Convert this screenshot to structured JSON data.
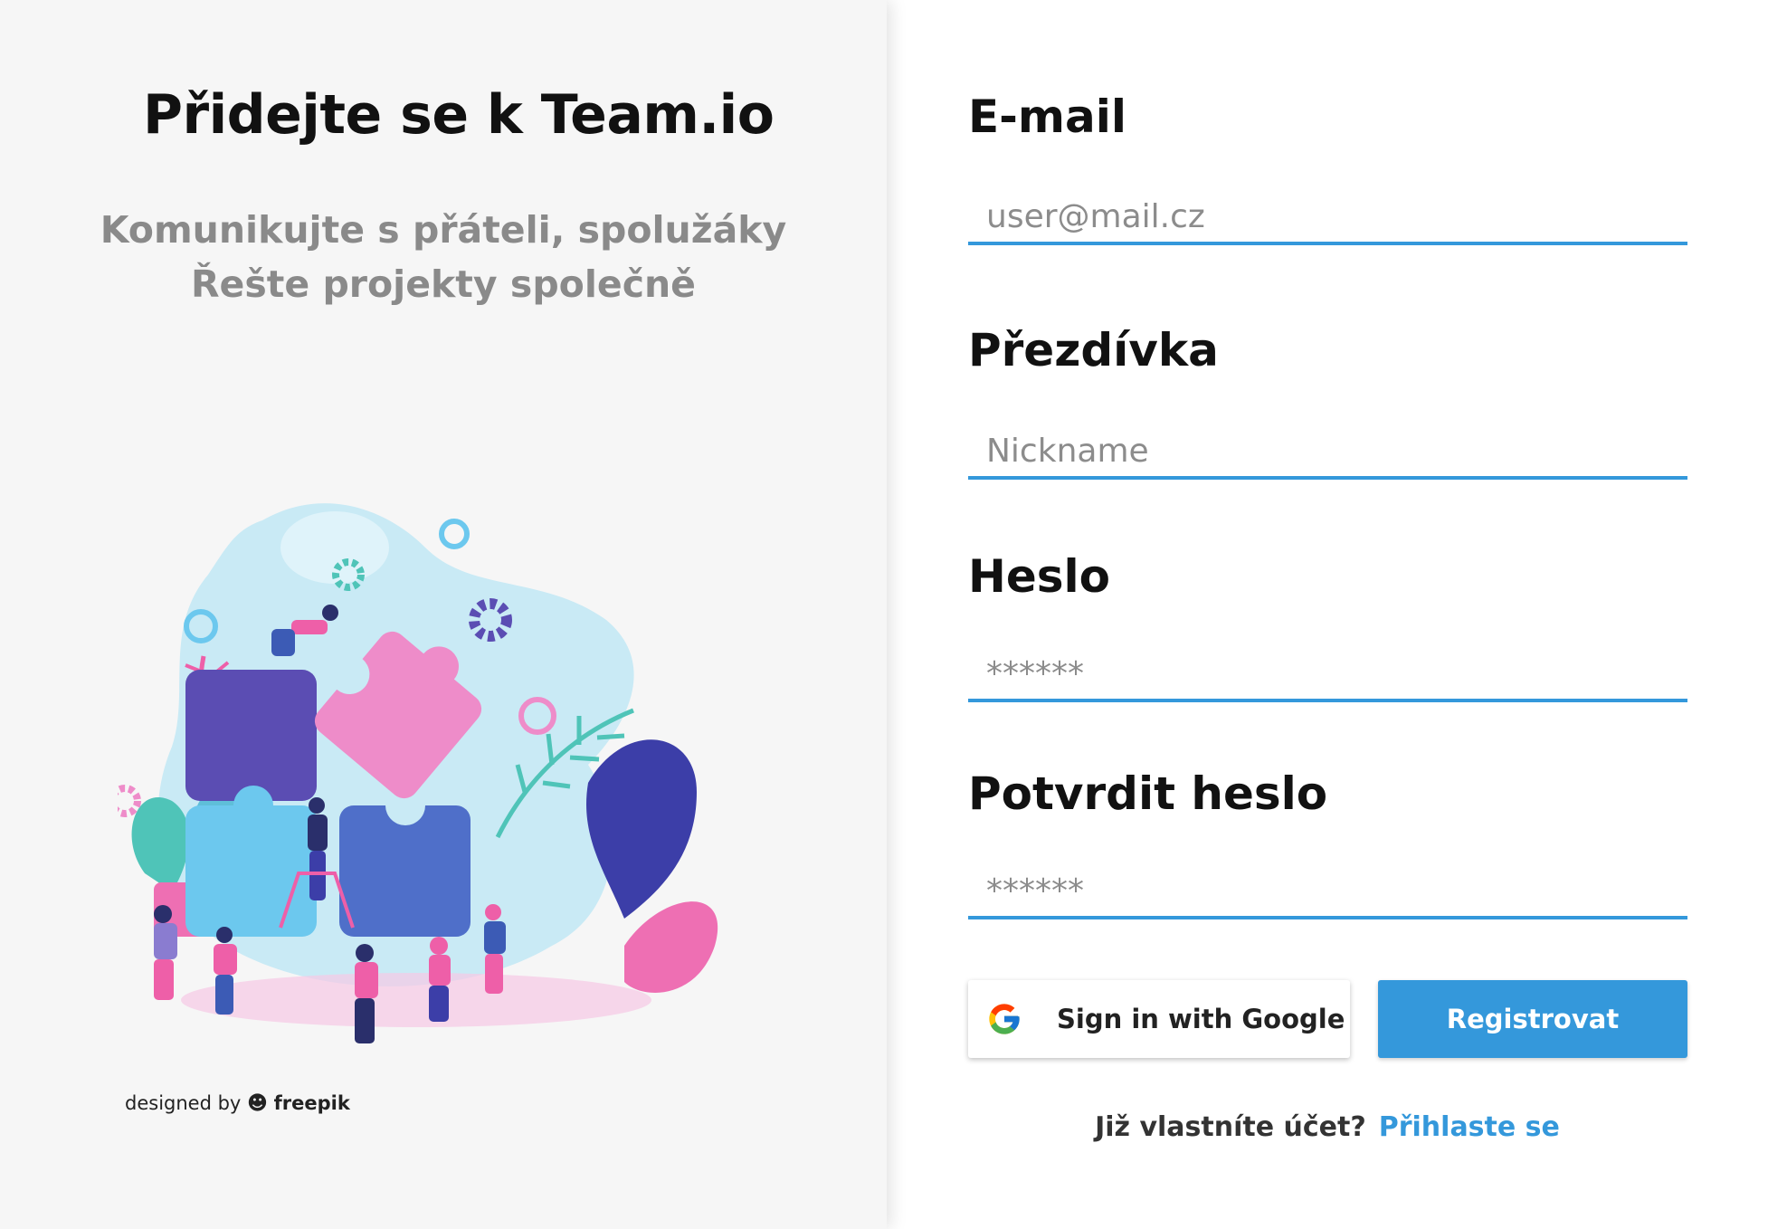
{
  "left": {
    "title": "Přidejte se k Team.io",
    "subtitle_line1": "Komunikujte s přáteli, spolužáky",
    "subtitle_line2": "Řešte projekty společně",
    "credit_prefix": "designed by",
    "credit_brand": "freepik"
  },
  "form": {
    "email": {
      "label": "E-mail",
      "placeholder": "user@mail.cz"
    },
    "nickname": {
      "label": "Přezdívka",
      "placeholder": "Nickname"
    },
    "password": {
      "label": "Heslo",
      "placeholder": "******"
    },
    "password_confirm": {
      "label": "Potvrdit heslo",
      "placeholder": "******"
    }
  },
  "buttons": {
    "google_label": "Sign in with Google",
    "google_icon": "google-g-icon",
    "register_label": "Registrovat"
  },
  "login": {
    "question": "Již vlastníte účet?",
    "link": "Přihlaste se"
  },
  "colors": {
    "accent": "#3498db",
    "panel_bg": "#f6f6f6",
    "puzzle_purple": "#5b4db3",
    "puzzle_pink": "#ee8cc9",
    "puzzle_lightblue": "#6cc8ee",
    "puzzle_blue": "#4f6fc9"
  }
}
